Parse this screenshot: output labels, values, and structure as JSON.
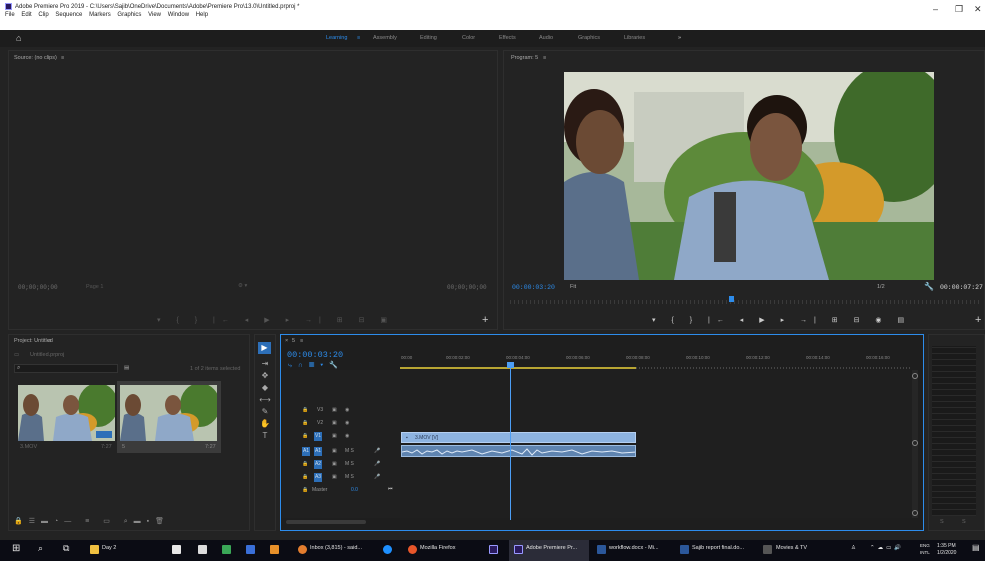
{
  "window": {
    "title": "Adobe Premiere Pro 2019 - C:\\Users\\Sajib\\OneDrive\\Documents\\Adobe\\Premiere Pro\\13.0\\Untitled.prproj *",
    "menu": [
      "File",
      "Edit",
      "Clip",
      "Sequence",
      "Markers",
      "Graphics",
      "View",
      "Window",
      "Help"
    ],
    "controls": {
      "minimize": "–",
      "restore": "❐",
      "close": "✕"
    }
  },
  "workspaces": {
    "home": "⌂",
    "items": [
      "Learning",
      "Assembly",
      "Editing",
      "Color",
      "Effects",
      "Audio",
      "Graphics",
      "Libraries"
    ],
    "active_index": 0,
    "active_menu": "≡",
    "more": "»"
  },
  "source": {
    "title": "Source: (no clips)",
    "menu": "≡",
    "timecode_left": "00;00;00;00",
    "page": "Page 1",
    "timecode_right": "00;00;00;00",
    "controls": "▾ { } |← ◂ ▶ ▸ →| ⊞ ⊟ ▣",
    "add": "+"
  },
  "program": {
    "title": "Program: 5",
    "menu": "≡",
    "timecode": "00:00:03:20",
    "fit": "Fit",
    "fraction": "1/2",
    "duration": "00:00:07:27",
    "controls": "▾ { } |← ◂ ▶ ▸ →| ⊞ ⊟ ◉ ▤",
    "add": "+"
  },
  "project": {
    "title": "Project: Untitled",
    "menu": "≡",
    "file": "Untitled.prproj",
    "items_selected": "1 of 2 items selected",
    "search_placeholder": "",
    "clips": [
      {
        "name": "3.MOV",
        "duration": "7:27"
      },
      {
        "name": "5",
        "duration": "7:27"
      }
    ]
  },
  "timeline": {
    "tab": "5",
    "menu": "≡",
    "timecode": "00:00:03:20",
    "ruler": [
      "00:00",
      "00:00:02:00",
      "00:00:04:00",
      "00:00:06:00",
      "00:00:08:00",
      "00:00:10:00",
      "00:00:12:00",
      "00:00:14:00",
      "00:00:16:00"
    ],
    "video_tracks": [
      "V3",
      "V2",
      "V1"
    ],
    "audio_tracks": [
      "A1",
      "A2",
      "A3"
    ],
    "track_ms": "M  S",
    "master": "Master",
    "master_value": "0.0",
    "clip_label": "3.MOV [V]"
  },
  "meter": {
    "labels": [
      "S",
      "S"
    ]
  },
  "taskbar": {
    "items": [
      {
        "label": "Day 2",
        "color": "#f0c040"
      },
      {
        "label": "Inbox (3,815) - said...",
        "color": "#e37d2e"
      },
      {
        "label": "Mozilla Firefox",
        "color": "#e8562a"
      },
      {
        "label": "Adobe Premiere Pr...",
        "color": "#2a1a5e"
      },
      {
        "label": "workflow.docx - Mi...",
        "color": "#2b579a"
      },
      {
        "label": "Sajib report final.do...",
        "color": "#2b579a"
      },
      {
        "label": "Movies & TV",
        "color": "#555555"
      }
    ],
    "lang": "ENG",
    "lang2": "INTL",
    "time": "1:35 PM",
    "date": "1/2/2020"
  }
}
